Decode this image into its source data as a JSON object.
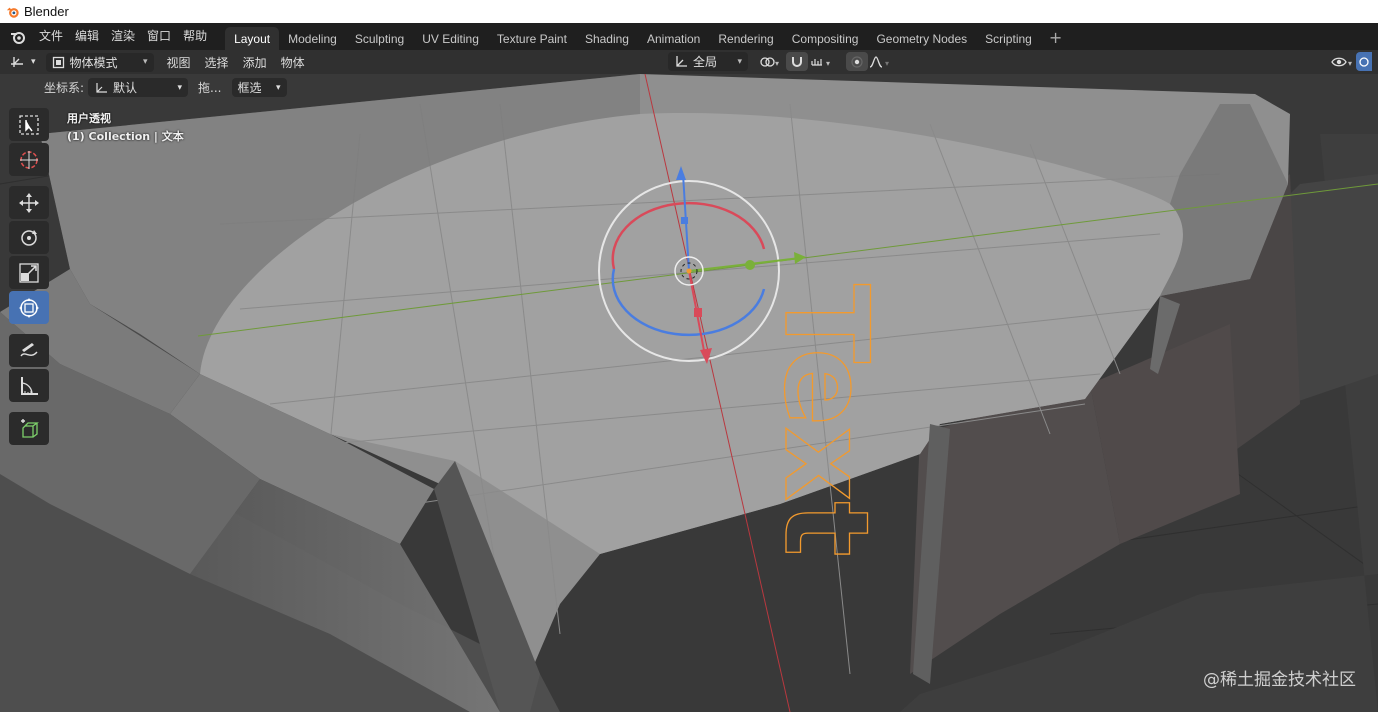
{
  "window": {
    "title": "Blender"
  },
  "menu": {
    "items": [
      "文件",
      "编辑",
      "渲染",
      "窗口",
      "帮助"
    ]
  },
  "workspace_tabs": [
    {
      "label": "Layout",
      "active": true
    },
    {
      "label": "Modeling"
    },
    {
      "label": "Sculpting"
    },
    {
      "label": "UV Editing"
    },
    {
      "label": "Texture Paint"
    },
    {
      "label": "Shading"
    },
    {
      "label": "Animation"
    },
    {
      "label": "Rendering"
    },
    {
      "label": "Compositing"
    },
    {
      "label": "Geometry Nodes"
    },
    {
      "label": "Scripting"
    }
  ],
  "header": {
    "mode": "物体模式",
    "menus": [
      "视图",
      "选择",
      "添加",
      "物体"
    ],
    "pivot": "全局"
  },
  "tool_settings": {
    "coord_label": "坐标系:",
    "coord_value": "默认",
    "drag_label": "拖...",
    "drag_value": "框选"
  },
  "viewport": {
    "view_name": "用户透视",
    "collection_info": "(1) Collection | 文本",
    "text_object": "Text"
  },
  "toolbar": {
    "tools": [
      "select-box",
      "cursor",
      "move",
      "rotate",
      "scale",
      "transform",
      "annotate",
      "measure",
      "add-cube"
    ],
    "active": "transform"
  },
  "watermark": "@稀土掘金技术社区",
  "colors": {
    "accent": "#4772b3",
    "x_axis": "#d93b4b",
    "y_axis": "#7ab03a",
    "z_axis": "#3f7ff0",
    "selection": "#f29a2e"
  }
}
